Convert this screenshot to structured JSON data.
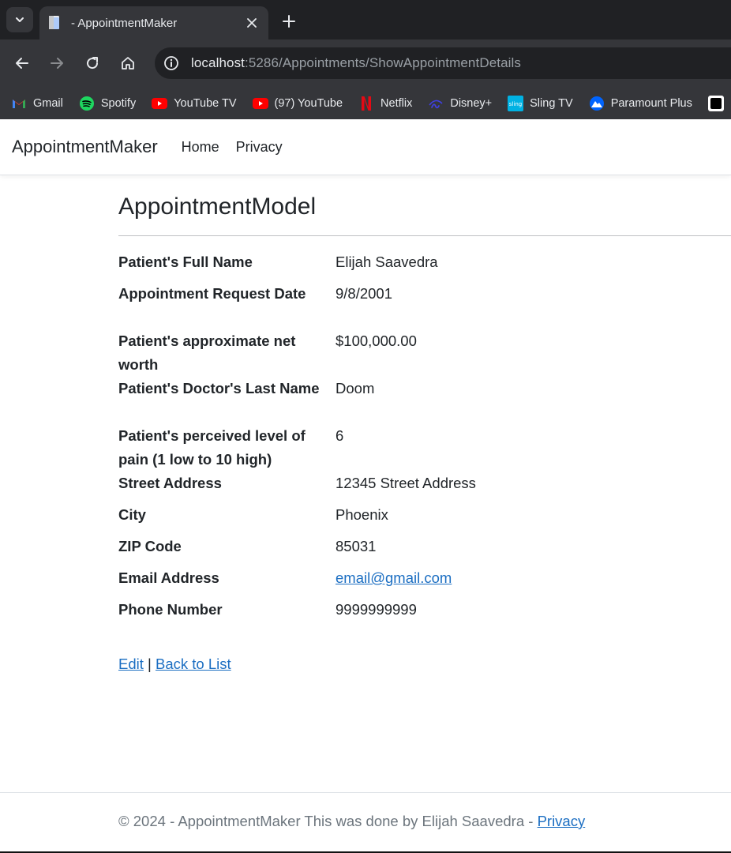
{
  "browser": {
    "tab_title": "- AppointmentMaker",
    "url_host": "localhost",
    "url_rest": ":5286/Appointments/ShowAppointmentDetails",
    "bookmarks": [
      {
        "label": "Gmail",
        "icon": "gmail-icon"
      },
      {
        "label": "Spotify",
        "icon": "spotify-icon"
      },
      {
        "label": "YouTube TV",
        "icon": "youtube-tv-icon"
      },
      {
        "label": "(97) YouTube",
        "icon": "youtube-icon"
      },
      {
        "label": "Netflix",
        "icon": "netflix-icon"
      },
      {
        "label": "Disney+",
        "icon": "disney-icon"
      },
      {
        "label": "Sling TV",
        "icon": "sling-icon"
      },
      {
        "label": "Paramount Plus",
        "icon": "paramount-icon"
      }
    ]
  },
  "navbar": {
    "brand": "AppointmentMaker",
    "links": [
      "Home",
      "Privacy"
    ]
  },
  "page": {
    "title": "AppointmentModel",
    "fields": [
      {
        "label": "Patient's Full Name",
        "value": "Elijah Saavedra"
      },
      {
        "label": "Appointment Request Date",
        "value": "9/8/2001"
      },
      {
        "label": "Patient's approximate net worth",
        "value": "$100,000.00"
      },
      {
        "label": "Patient's Doctor's Last Name",
        "value": "Doom"
      },
      {
        "label": "Patient's perceived level of pain (1 low to 10 high)",
        "value": "6"
      },
      {
        "label": "Street Address",
        "value": "12345 Street Address"
      },
      {
        "label": "City",
        "value": "Phoenix"
      },
      {
        "label": "ZIP Code",
        "value": "85031"
      },
      {
        "label": "Email Address",
        "value": "email@gmail.com"
      },
      {
        "label": "Phone Number",
        "value": "9999999999"
      }
    ],
    "actions": {
      "edit": "Edit",
      "separator": "|",
      "back": "Back to List"
    }
  },
  "footer": {
    "text": "© 2024 - AppointmentMaker This was done by Elijah Saavedra - ",
    "privacy": "Privacy"
  },
  "colors": {
    "link": "#1b6ec2",
    "chrome_dark": "#202124",
    "chrome": "#35363a"
  }
}
